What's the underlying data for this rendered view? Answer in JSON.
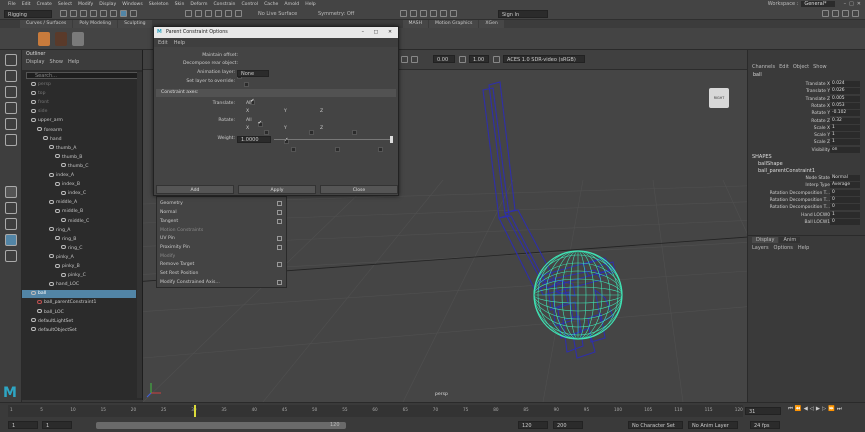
{
  "menubar": {
    "items": [
      "File",
      "Edit",
      "Create",
      "Select",
      "Modify",
      "Display",
      "Windows",
      "Skeleton",
      "Skin",
      "Deform",
      "Constrain",
      "Control",
      "Cache",
      "Arnold",
      "Help"
    ],
    "workspace_label": "Workspace :",
    "workspace_value": "General*"
  },
  "status": {
    "mode": "Rigging",
    "live_surface": "No Live Surface",
    "symmetry": "Symmetry: Off",
    "signin": "Sign In"
  },
  "shelf_tabs": [
    "Curves / Surfaces",
    "Poly Modeling",
    "Sculpting",
    "MASH",
    "Motion Graphics",
    "XGen"
  ],
  "outliner": {
    "title": "Outliner",
    "menu": [
      "Display",
      "Show",
      "Help"
    ],
    "search_placeholder": "Search...",
    "items": [
      "persp",
      "top",
      "front",
      "side",
      "upper_arm",
      "forearm",
      "hand",
      "thumb_A",
      "thumb_B",
      "thumb_C",
      "index_A",
      "index_B",
      "index_C",
      "middle_A",
      "middle_B",
      "middle_C",
      "ring_A",
      "ring_B",
      "ring_C",
      "pinky_A",
      "pinky_B",
      "pinky_C",
      "hand_LOC",
      "ball",
      "ball_parentConstraint1",
      "ball_LOC",
      "defaultLightSet",
      "defaultObjectSet"
    ]
  },
  "viewport": {
    "camera_label": "persp",
    "cube_label": "RIGHT",
    "exposure": "0.00",
    "gamma": "1.00",
    "colorspace": "ACES 1.0 SDR-video (sRGB)"
  },
  "dialog": {
    "title": "Parent Constraint Options",
    "menu": [
      "Edit",
      "Help"
    ],
    "maintain_offset": "Maintain offset:",
    "decompose": "Decompose rear object:",
    "anim_layer": "Animation layer:",
    "anim_layer_value": "None",
    "set_layer": "Set layer to override:",
    "section": "Constraint axes:",
    "translate": "Translate:",
    "rotate": "Rotate:",
    "all": "All",
    "x": "X",
    "y": "Y",
    "z": "Z",
    "weight": "Weight:",
    "weight_value": "1.0000",
    "buttons": [
      "Add",
      "Apply",
      "Close"
    ]
  },
  "context_menu": {
    "items": [
      "Geometry",
      "Normal",
      "Tangent"
    ],
    "header1": "Motion Constraints",
    "items2": [
      "UV Pin",
      "Proximity Pin"
    ],
    "header2": "Modify",
    "items3": [
      "Remove Target",
      "Set Rest Position",
      "Modify Constrained Axis..."
    ]
  },
  "channelbox": {
    "menu": [
      "Channels",
      "Edit",
      "Object",
      "Show"
    ],
    "object": "ball",
    "channels": [
      {
        "name": "Translate X",
        "value": "0.024"
      },
      {
        "name": "Translate Y",
        "value": "0.026"
      },
      {
        "name": "Translate Z",
        "value": "0.005"
      },
      {
        "name": "Rotate X",
        "value": "0.053"
      },
      {
        "name": "Rotate Y",
        "value": "-0.102"
      },
      {
        "name": "Rotate Z",
        "value": "0.32"
      },
      {
        "name": "Scale X",
        "value": "1"
      },
      {
        "name": "Scale Y",
        "value": "1"
      },
      {
        "name": "Scale Z",
        "value": "1"
      },
      {
        "name": "Visibility",
        "value": "on"
      }
    ],
    "shapes_header": "SHAPES",
    "shape": "ballShape",
    "inputs": "ball_parentConstraint1",
    "inputs_rows": [
      {
        "name": "Node State",
        "value": "Normal"
      },
      {
        "name": "Interp Type",
        "value": "Average"
      },
      {
        "name": "Rotation Decomposition T...",
        "value": "0"
      },
      {
        "name": "Rotation Decomposition T...",
        "value": "0"
      },
      {
        "name": "Rotation Decomposition T...",
        "value": "0"
      },
      {
        "name": "Hand LOCW0",
        "value": "1"
      },
      {
        "name": "Ball LOCW1",
        "value": "0"
      }
    ]
  },
  "layers": {
    "tabs": [
      "Display",
      "Anim"
    ],
    "menu": [
      "Layers",
      "Options",
      "Help"
    ]
  },
  "timeline": {
    "ticks": [
      "1",
      "5",
      "10",
      "15",
      "20",
      "25",
      "30",
      "35",
      "40",
      "45",
      "50",
      "55",
      "60",
      "65",
      "70",
      "75",
      "80",
      "85",
      "90",
      "95",
      "100",
      "105",
      "110",
      "115",
      "120"
    ],
    "current_frame": "31",
    "range_start": "1",
    "range_end": "120",
    "anim_start": "120",
    "anim_end": "200",
    "char_set": "No Character Set",
    "anim_layer": "No Anim Layer",
    "fps": "24 fps"
  },
  "colors": {
    "accent": "#5285a6",
    "ball": "#39e3b0",
    "rig": "#2f2fa8",
    "bg": "#3a3a3a",
    "viewport": "#454545"
  }
}
